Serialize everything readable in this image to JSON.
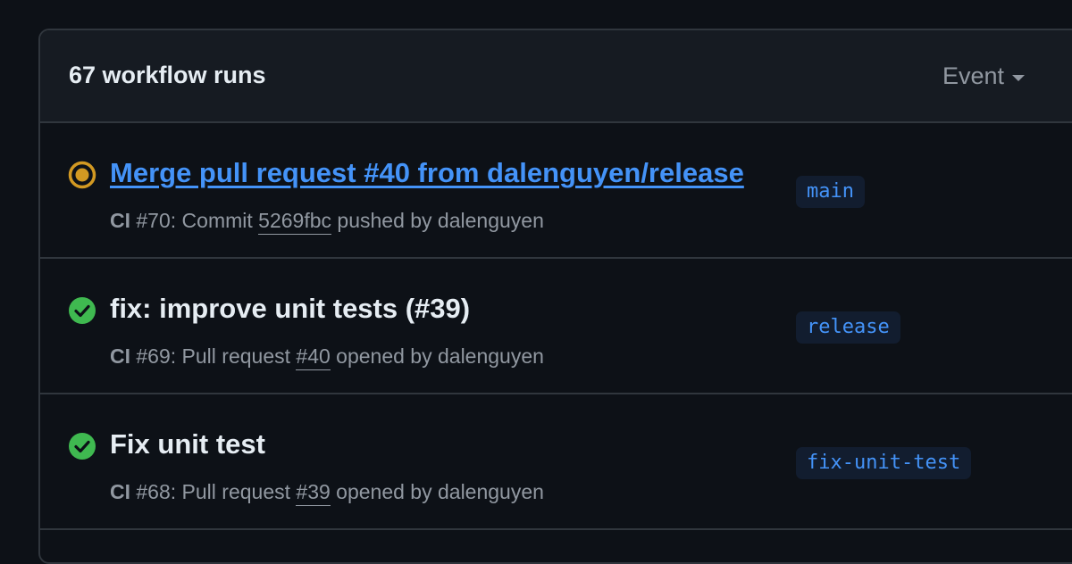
{
  "header": {
    "title": "67 workflow runs",
    "event_filter_label": "Event"
  },
  "runs": [
    {
      "status": "in-progress",
      "status_color": "#d29922",
      "title": "Merge pull request #40 from dalenguyen/release",
      "workflow": "CI",
      "meta_prefix": "#70: Commit",
      "meta_ref": "5269fbc",
      "meta_suffix": "pushed by dalenguyen",
      "branch": "main"
    },
    {
      "status": "success",
      "status_color": "#3fb950",
      "title": "fix: improve unit tests (#39)",
      "workflow": "CI",
      "meta_prefix": "#69: Pull request",
      "meta_ref": "#40",
      "meta_suffix": "opened by dalenguyen",
      "branch": "release"
    },
    {
      "status": "success",
      "status_color": "#3fb950",
      "title": "Fix unit test",
      "workflow": "CI",
      "meta_prefix": "#68: Pull request",
      "meta_ref": "#39",
      "meta_suffix": "opened by dalenguyen",
      "branch": "fix-unit-test"
    }
  ]
}
